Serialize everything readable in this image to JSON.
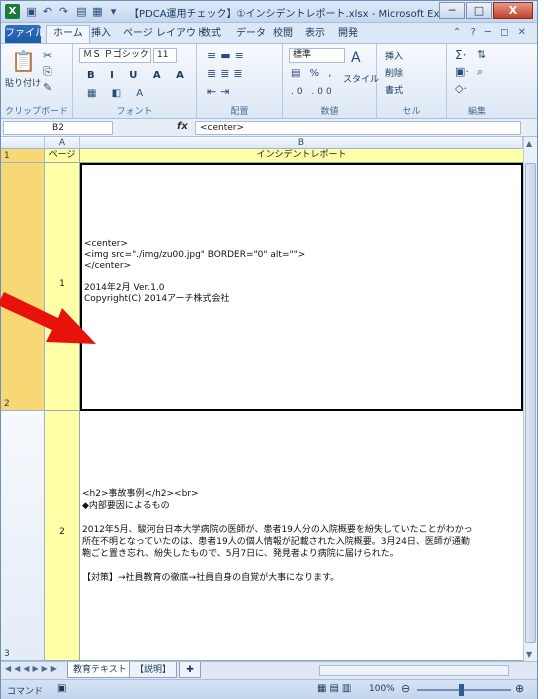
{
  "window": {
    "title": "【PDCA運用チェック】①インシデントレポート.xlsx - Microsoft Excel",
    "minimize": "─",
    "maximize": "□",
    "close": "X"
  },
  "tabs": [
    "ファイル",
    "ホーム",
    "挿入",
    "ページ レイアウト",
    "数式",
    "データ",
    "校閲",
    "表示",
    "開発"
  ],
  "ribbon": {
    "paste": "貼り付け",
    "clipboard_label": "クリップボード",
    "font_name": "ＭＳ Ｐゴシック",
    "font_size": "11",
    "font_label": "フォント",
    "align_label": "配置",
    "number_format": "標準",
    "number_label": "数値",
    "style": "スタイル",
    "insert": "挿入",
    "delete": "削除",
    "format": "書式",
    "cells_label": "セル",
    "edit_label": "編集"
  },
  "formula_bar": {
    "name_box": "B2",
    "fx": "fx",
    "formula": "<center>"
  },
  "columns": [
    "A",
    "B"
  ],
  "header_row": {
    "row": "1",
    "a": "ページ",
    "b": "インシデントレポート"
  },
  "rows": [
    {
      "row": "2",
      "a": "1",
      "lines": [
        "<center>",
        "<img src=\"./img/zu00.jpg\" BORDER=\"0\" alt=\"\">",
        "</center>",
        "",
        "2014年2月 Ver.1.0",
        "Copyright(C) 2014アーチ株式会社"
      ]
    },
    {
      "row": "3",
      "a": "2",
      "lines": [
        "<h2>事故事例</h2><br>",
        "◆内部要因によるもの",
        "",
        "2012年5月、駿河台日本大学病院の医師が、患者19人分の入院概要を紛失していたことがわかっ",
        "所在不明となっていたのは、患者19人の個人情報が記載された入院概要。3月24日、医師が通勤",
        "鞄ごと置き忘れ、紛失したもので、5月7日に、発見者より病院に届けられた。",
        "",
        "【対策】→社員教育の徹底→社員自身の自覚が大事になります。"
      ]
    }
  ],
  "sheet_tabs": [
    "教育テキスト",
    "【説明】"
  ],
  "status": {
    "mode": "コマンド",
    "zoom": "100%"
  },
  "colors": {
    "row_header": "#f8d775",
    "col_a": "#ffffa8",
    "arrow": "#e8120c"
  }
}
